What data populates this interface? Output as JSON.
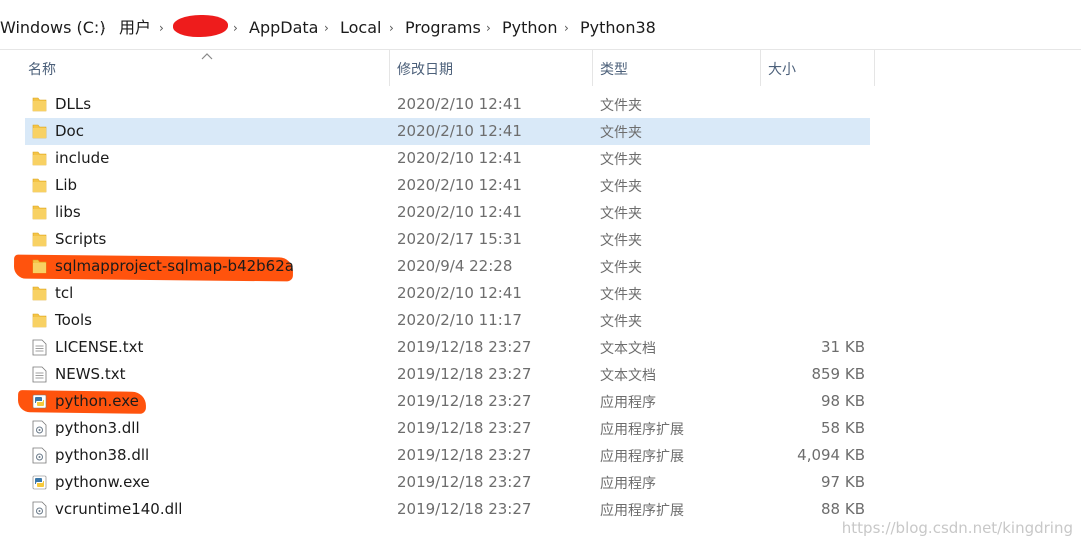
{
  "breadcrumb": {
    "items": [
      "Windows (C:)",
      "用户",
      "",
      "AppData",
      "Local",
      "Programs",
      "Python",
      "Python38"
    ],
    "separator": "›"
  },
  "columns": {
    "name": "名称",
    "modified": "修改日期",
    "type": "类型",
    "size": "大小"
  },
  "files": [
    {
      "name": "DLLs",
      "modified": "2020/2/10 12:41",
      "type": "文件夹",
      "size": "",
      "icon": "folder-icon"
    },
    {
      "name": "Doc",
      "modified": "2020/2/10 12:41",
      "type": "文件夹",
      "size": "",
      "icon": "folder-icon"
    },
    {
      "name": "include",
      "modified": "2020/2/10 12:41",
      "type": "文件夹",
      "size": "",
      "icon": "folder-icon"
    },
    {
      "name": "Lib",
      "modified": "2020/2/10 12:41",
      "type": "文件夹",
      "size": "",
      "icon": "folder-icon"
    },
    {
      "name": "libs",
      "modified": "2020/2/10 12:41",
      "type": "文件夹",
      "size": "",
      "icon": "folder-icon"
    },
    {
      "name": "Scripts",
      "modified": "2020/2/17 15:31",
      "type": "文件夹",
      "size": "",
      "icon": "folder-icon"
    },
    {
      "name": "sqlmapproject-sqlmap-b42b62a",
      "modified": "2020/9/4 22:28",
      "type": "文件夹",
      "size": "",
      "icon": "folder-icon"
    },
    {
      "name": "tcl",
      "modified": "2020/2/10 12:41",
      "type": "文件夹",
      "size": "",
      "icon": "folder-icon"
    },
    {
      "name": "Tools",
      "modified": "2020/2/10 11:17",
      "type": "文件夹",
      "size": "",
      "icon": "folder-icon"
    },
    {
      "name": "LICENSE.txt",
      "modified": "2019/12/18 23:27",
      "type": "文本文档",
      "size": "31 KB",
      "icon": "text-file-icon"
    },
    {
      "name": "NEWS.txt",
      "modified": "2019/12/18 23:27",
      "type": "文本文档",
      "size": "859 KB",
      "icon": "text-file-icon"
    },
    {
      "name": "python.exe",
      "modified": "2019/12/18 23:27",
      "type": "应用程序",
      "size": "98 KB",
      "icon": "python-exe-icon"
    },
    {
      "name": "python3.dll",
      "modified": "2019/12/18 23:27",
      "type": "应用程序扩展",
      "size": "58 KB",
      "icon": "dll-file-icon"
    },
    {
      "name": "python38.dll",
      "modified": "2019/12/18 23:27",
      "type": "应用程序扩展",
      "size": "4,094 KB",
      "icon": "dll-file-icon"
    },
    {
      "name": "pythonw.exe",
      "modified": "2019/12/18 23:27",
      "type": "应用程序",
      "size": "97 KB",
      "icon": "python-exe-icon"
    },
    {
      "name": "vcruntime140.dll",
      "modified": "2019/12/18 23:27",
      "type": "应用程序扩展",
      "size": "88 KB",
      "icon": "dll-file-icon"
    }
  ],
  "selected_row": "Doc",
  "watermark": "https://blog.csdn.net/kingdring",
  "colors": {
    "selection": "#d9e9f8",
    "highlight": "#ff4a00",
    "redaction": "#ee1c1c",
    "folder": "#f4c447"
  }
}
